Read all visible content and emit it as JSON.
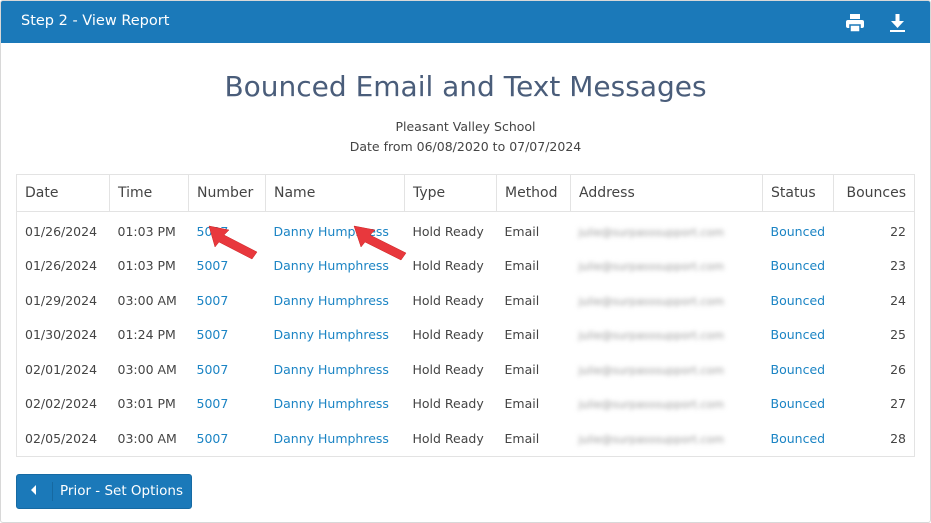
{
  "header": {
    "title": "Step 2 - View Report",
    "icons": [
      "print-icon",
      "download-icon"
    ],
    "background": "#1b79b9"
  },
  "report": {
    "title": "Bounced Email and Text Messages",
    "school": "Pleasant Valley School",
    "date_range": "Date from 06/08/2020 to 07/07/2024"
  },
  "table": {
    "columns": [
      "Date",
      "Time",
      "Number",
      "Name",
      "Type",
      "Method",
      "Address",
      "Status",
      "Bounces"
    ],
    "rows": [
      {
        "date": "01/26/2024",
        "time": "01:03 PM",
        "number": "5007",
        "name": "Danny Humphress",
        "type": "Hold Ready",
        "method": "Email",
        "address": "julie@surpasssupport.com",
        "status": "Bounced",
        "bounces": "22"
      },
      {
        "date": "01/26/2024",
        "time": "01:03 PM",
        "number": "5007",
        "name": "Danny Humphress",
        "type": "Hold Ready",
        "method": "Email",
        "address": "julie@surpasssupport.com",
        "status": "Bounced",
        "bounces": "23"
      },
      {
        "date": "01/29/2024",
        "time": "03:00 AM",
        "number": "5007",
        "name": "Danny Humphress",
        "type": "Hold Ready",
        "method": "Email",
        "address": "julie@surpasssupport.com",
        "status": "Bounced",
        "bounces": "24"
      },
      {
        "date": "01/30/2024",
        "time": "01:24 PM",
        "number": "5007",
        "name": "Danny Humphress",
        "type": "Hold Ready",
        "method": "Email",
        "address": "julie@surpasssupport.com",
        "status": "Bounced",
        "bounces": "25"
      },
      {
        "date": "02/01/2024",
        "time": "03:00 AM",
        "number": "5007",
        "name": "Danny Humphress",
        "type": "Hold Ready",
        "method": "Email",
        "address": "julie@surpasssupport.com",
        "status": "Bounced",
        "bounces": "26"
      },
      {
        "date": "02/02/2024",
        "time": "03:01 PM",
        "number": "5007",
        "name": "Danny Humphress",
        "type": "Hold Ready",
        "method": "Email",
        "address": "julie@surpasssupport.com",
        "status": "Bounced",
        "bounces": "27"
      },
      {
        "date": "02/05/2024",
        "time": "03:00 AM",
        "number": "5007",
        "name": "Danny Humphress",
        "type": "Hold Ready",
        "method": "Email",
        "address": "julie@surpasssupport.com",
        "status": "Bounced",
        "bounces": "28"
      }
    ]
  },
  "footer": {
    "prior_label": "Prior - Set Options"
  },
  "colors": {
    "accent": "#1b79b9",
    "link": "#1b84c4",
    "title": "#4a5d7a",
    "annotation_arrow": "#e8383d"
  }
}
